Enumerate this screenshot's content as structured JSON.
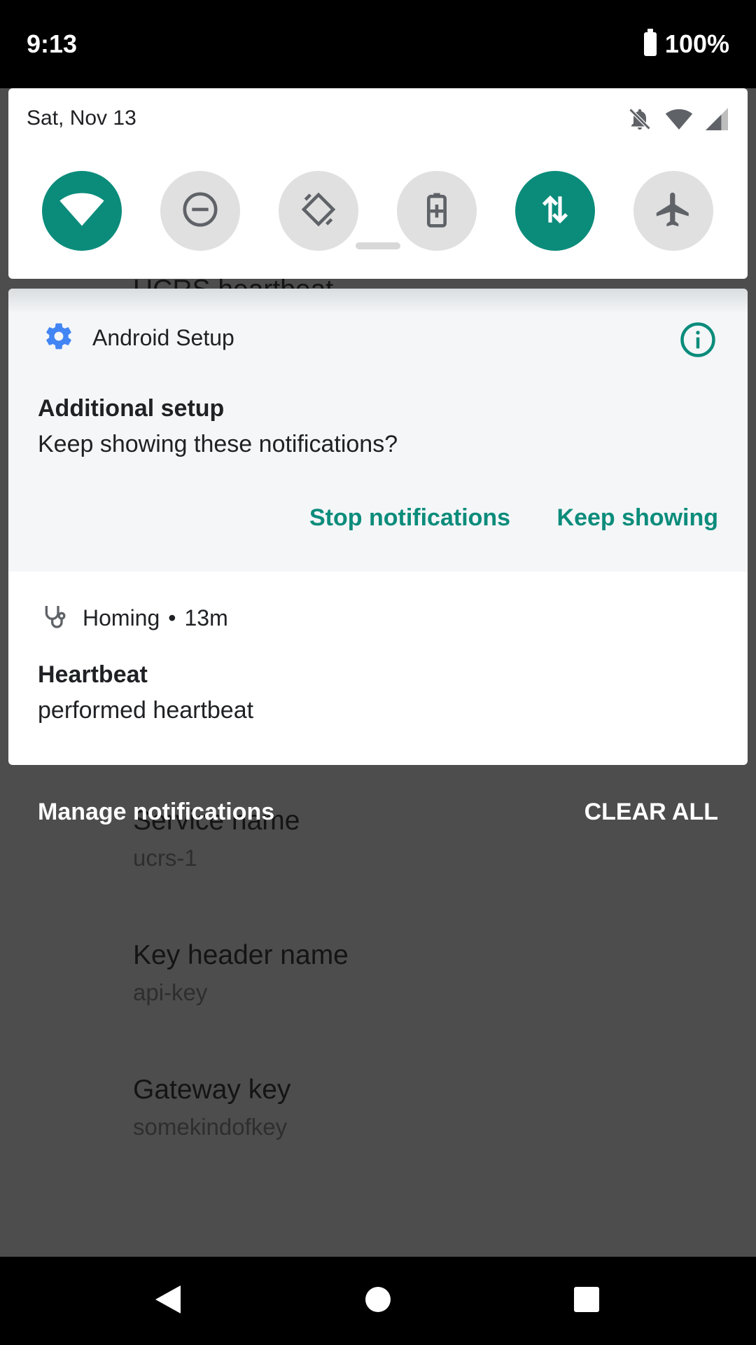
{
  "status_bar": {
    "time": "9:13",
    "battery": "100%"
  },
  "background_app": {
    "partial_heading": "UCRS heartbeat",
    "fields": [
      {
        "title": "Service name",
        "value": "ucrs-1"
      },
      {
        "title": "Key header name",
        "value": "api-key"
      },
      {
        "title": "Gateway key",
        "value": "somekindofkey"
      }
    ]
  },
  "quick_settings": {
    "date": "Sat, Nov 13",
    "status_icons": [
      "bell-off-icon",
      "wifi-icon",
      "cell-signal-icon"
    ],
    "tiles": [
      {
        "name": "wifi",
        "icon": "wifi-icon",
        "active": true
      },
      {
        "name": "do-not-disturb",
        "icon": "dnd-icon",
        "active": false
      },
      {
        "name": "auto-rotate",
        "icon": "rotate-icon",
        "active": false
      },
      {
        "name": "battery-saver",
        "icon": "battery-saver-icon",
        "active": false
      },
      {
        "name": "mobile-data",
        "icon": "data-arrows-icon",
        "active": true
      },
      {
        "name": "airplane-mode",
        "icon": "airplane-icon",
        "active": false
      }
    ]
  },
  "notifications": {
    "setup": {
      "app_name": "Android Setup",
      "title": "Additional setup",
      "text": "Keep showing these notifications?",
      "actions": {
        "stop": "Stop notifications",
        "keep": "Keep showing"
      }
    },
    "homing": {
      "app_name": "Homing",
      "separator": "•",
      "time": "13m",
      "title": "Heartbeat",
      "text": "performed heartbeat"
    }
  },
  "shade_footer": {
    "manage": "Manage notifications",
    "clear_all": "CLEAR ALL"
  },
  "colors": {
    "accent": "#0b8c7b",
    "tile_off": "#e0e0e0",
    "gear_blue": "#4285f4"
  }
}
